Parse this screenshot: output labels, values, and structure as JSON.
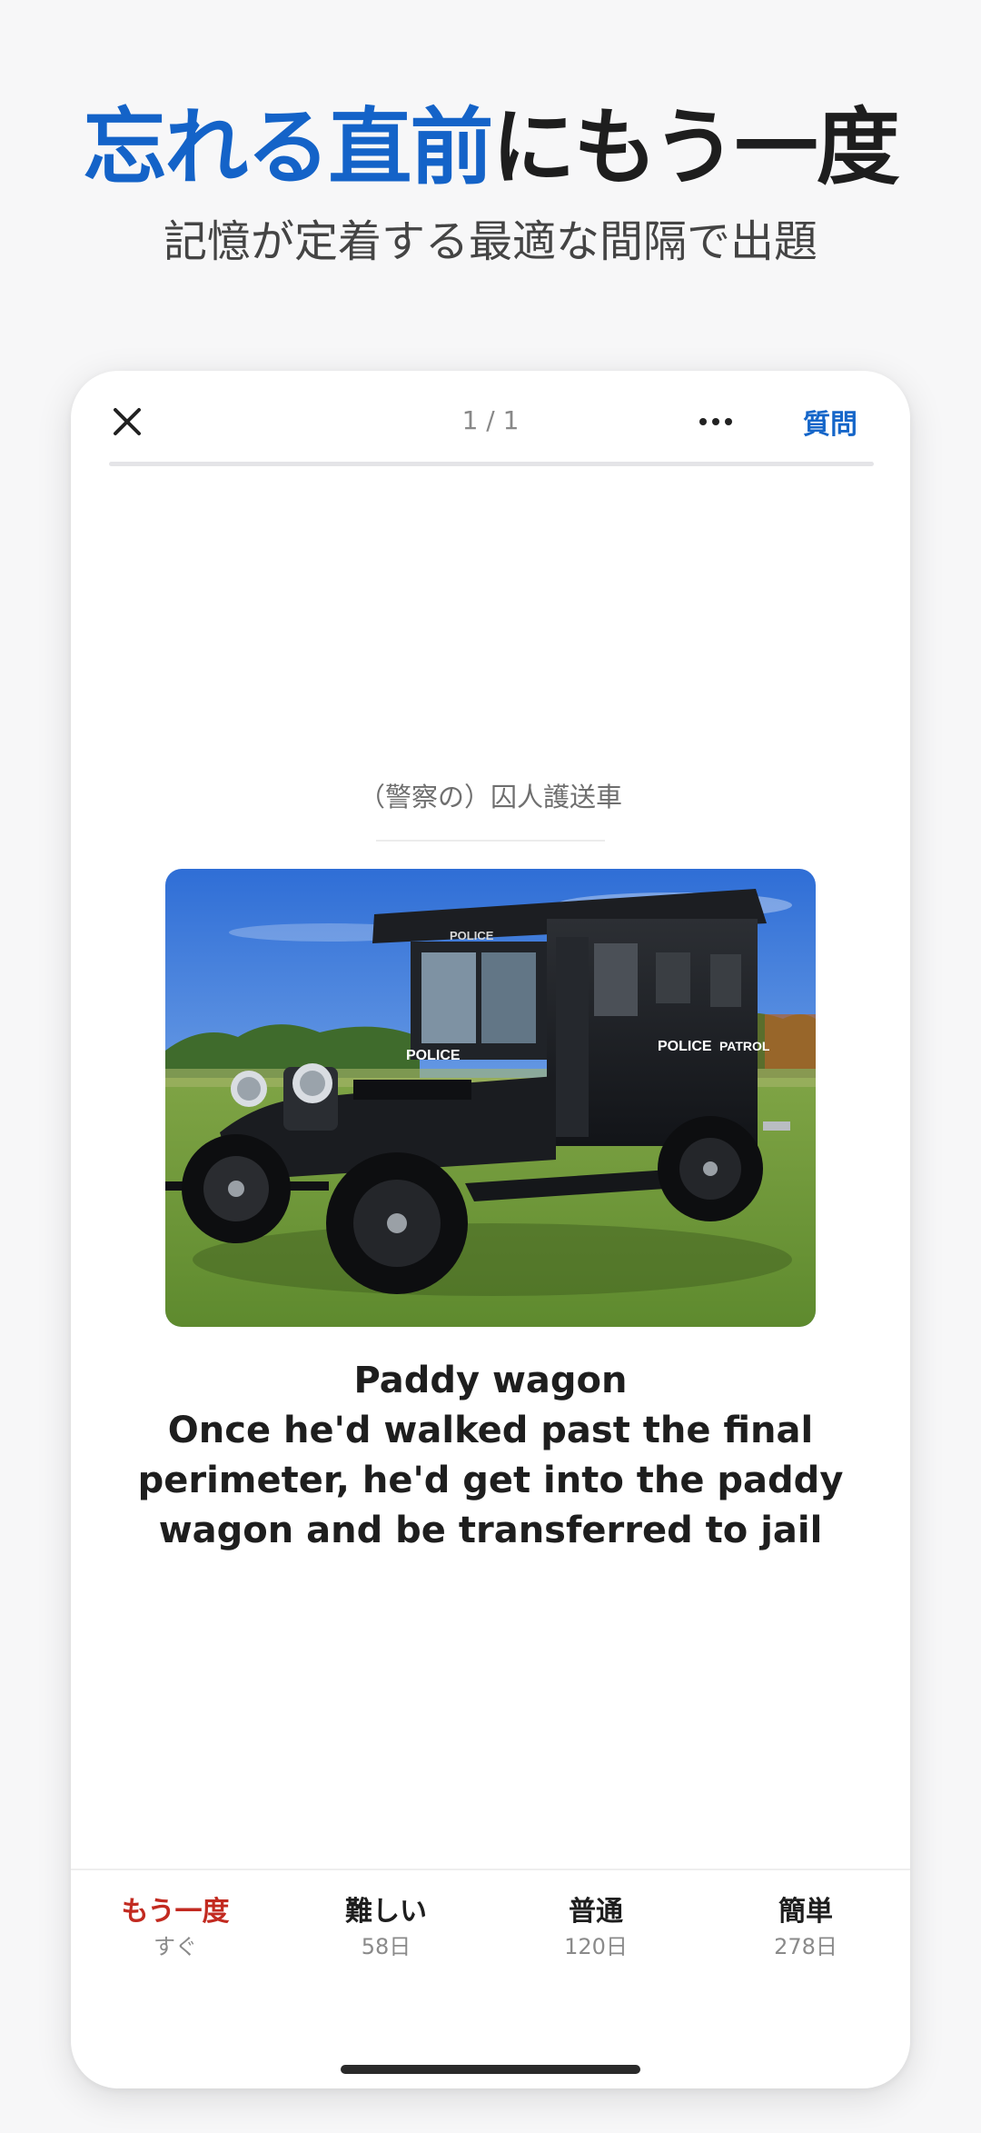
{
  "promo": {
    "headline_accent": "忘れる直前",
    "headline_rest": "にもう一度",
    "subheadline": "記憶が定着する最適な間隔で出題"
  },
  "card": {
    "counter": "1 / 1",
    "ask_label": "質問",
    "progress": 0,
    "prompt": "（警察の）囚人護送車",
    "image": {
      "vehicle_text_hood": "POLICE",
      "vehicle_text_roof": "POLICE",
      "vehicle_text_side_1": "POLICE",
      "vehicle_text_side_2": "PATROL"
    },
    "answer_lines": [
      "Paddy wagon",
      "Once he'd walked past the final",
      "perimeter, he'd get into the paddy",
      "wagon and be transferred to jail"
    ]
  },
  "choices": [
    {
      "label": "もう一度",
      "interval": "すぐ"
    },
    {
      "label": "難しい",
      "interval": "58日"
    },
    {
      "label": "普通",
      "interval": "120日"
    },
    {
      "label": "簡単",
      "interval": "278日"
    }
  ],
  "colors": {
    "accent_blue": "#1463c8",
    "again_red": "#c22a20",
    "text_dark": "#1e1e1e"
  },
  "icons": {
    "close": "close-icon",
    "more": "ellipsis-icon"
  }
}
